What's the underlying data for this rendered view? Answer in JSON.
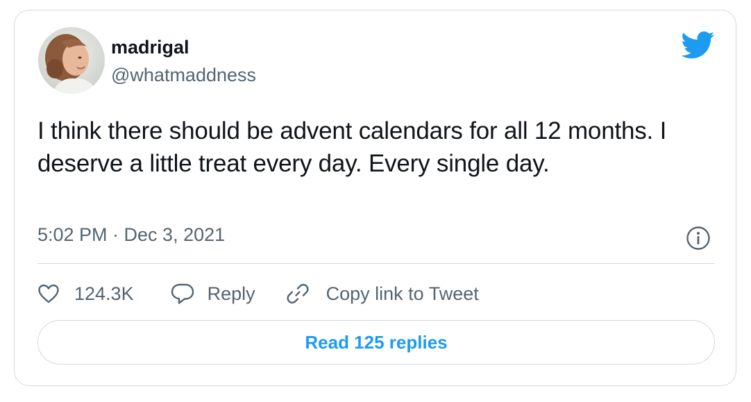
{
  "author": {
    "display_name": "madrigal",
    "handle": "@whatmaddness"
  },
  "tweet": {
    "text": "I think there should be advent calendars for all 12 months. I deserve a little treat every day. Every single day.",
    "timestamp": "5:02 PM · Dec 3, 2021"
  },
  "actions": {
    "like_count": "124.3K",
    "reply_label": "Reply",
    "copy_link_label": "Copy link to Tweet"
  },
  "read_replies_label": "Read 125 replies",
  "icons": {
    "brand": "twitter-bird-icon",
    "info": "info-icon",
    "like": "heart-icon",
    "reply": "speech-bubble-icon",
    "copy": "link-icon"
  },
  "colors": {
    "brand_blue": "#1d9bf0",
    "text_primary": "#0f1419",
    "text_secondary": "#536471",
    "border": "#cfd9de"
  }
}
